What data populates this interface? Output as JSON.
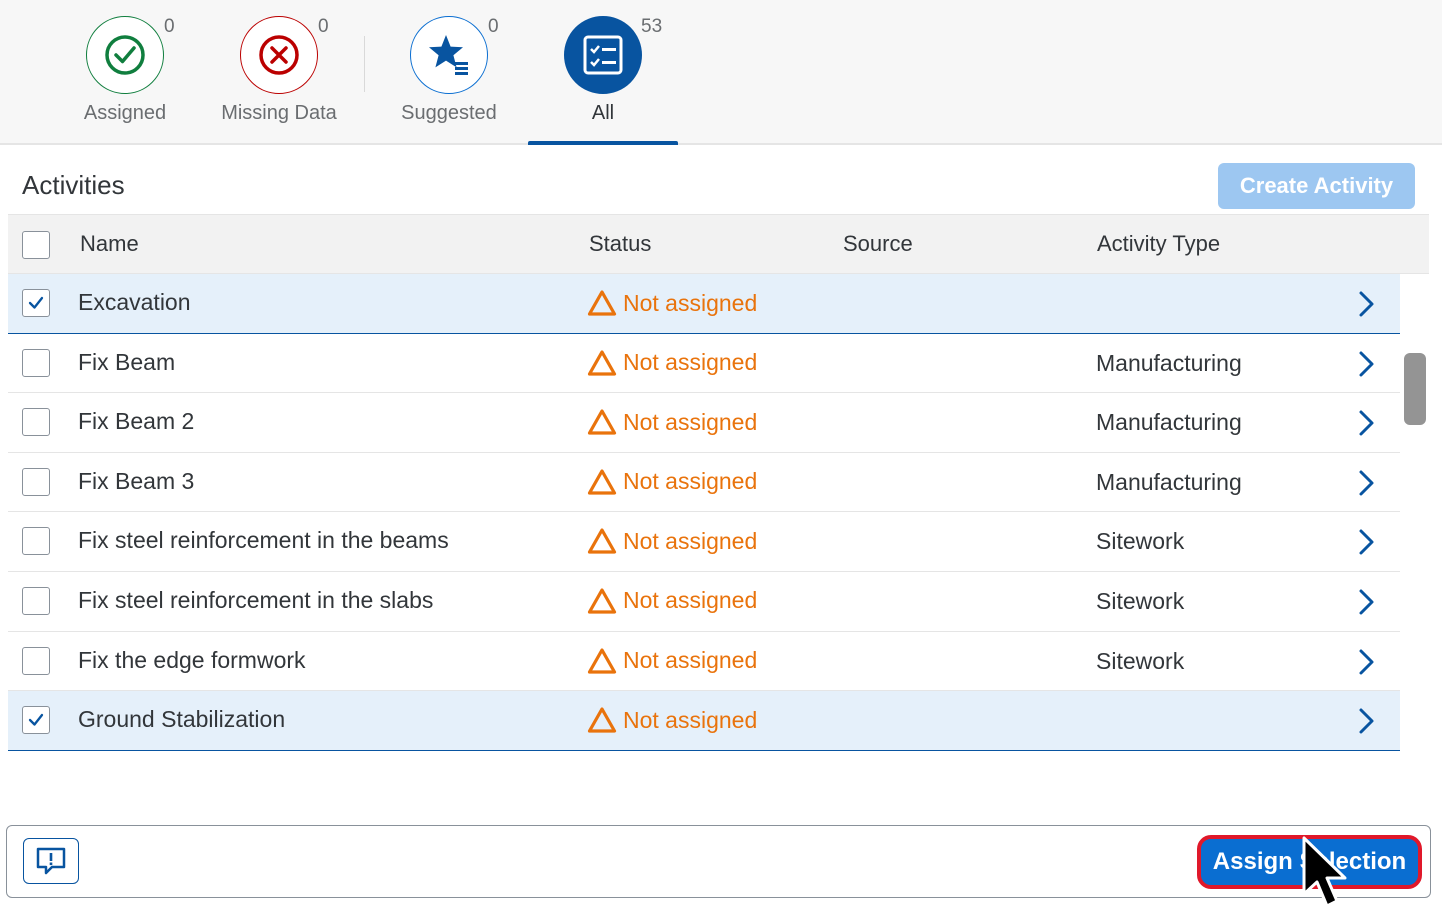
{
  "tabs": [
    {
      "label": "Assigned",
      "count": "0",
      "icon": "check-circle-icon",
      "color": "#107e3e"
    },
    {
      "label": "Missing Data",
      "count": "0",
      "icon": "cancel-circle-icon",
      "color": "#bb0000"
    },
    {
      "label": "Suggested",
      "count": "0",
      "icon": "star-list-icon",
      "color": "#0a6ed1"
    },
    {
      "label": "All",
      "count": "53",
      "icon": "checklist-icon",
      "color": "#0854a0",
      "selected": true
    }
  ],
  "table": {
    "title": "Activities",
    "create_button": "Create Activity",
    "columns": {
      "name": "Name",
      "status": "Status",
      "source": "Source",
      "activity_type": "Activity Type"
    },
    "rows": [
      {
        "name": "Excavation",
        "status": "Not assigned",
        "source": "",
        "activity_type": "",
        "selected": true
      },
      {
        "name": "Fix Beam",
        "status": "Not assigned",
        "source": "",
        "activity_type": "Manufacturing",
        "selected": false
      },
      {
        "name": "Fix Beam 2",
        "status": "Not assigned",
        "source": "",
        "activity_type": "Manufacturing",
        "selected": false
      },
      {
        "name": "Fix Beam 3",
        "status": "Not assigned",
        "source": "",
        "activity_type": "Manufacturing",
        "selected": false
      },
      {
        "name": "Fix steel reinforcement in the beams",
        "status": "Not assigned",
        "source": "",
        "activity_type": "Sitework",
        "selected": false
      },
      {
        "name": "Fix steel reinforcement in the slabs",
        "status": "Not assigned",
        "source": "",
        "activity_type": "Sitework",
        "selected": false
      },
      {
        "name": "Fix the edge formwork",
        "status": "Not assigned",
        "source": "",
        "activity_type": "Sitework",
        "selected": false
      },
      {
        "name": "Ground Stabilization",
        "status": "Not assigned",
        "source": "",
        "activity_type": "",
        "selected": true
      }
    ]
  },
  "footer": {
    "message_icon": "message-popup-icon",
    "assign_button": "Assign Selection"
  },
  "colors": {
    "accent": "#0854a0",
    "button_blue": "#0a6ed1",
    "warning": "#e9730c",
    "highlight_border": "#e0182a"
  }
}
